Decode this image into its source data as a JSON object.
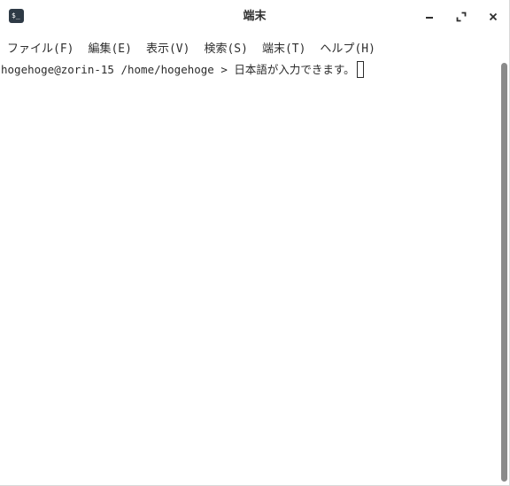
{
  "window": {
    "title": "端末",
    "app_icon_glyph": "$_"
  },
  "menubar": {
    "items": [
      {
        "label": "ファイル(F)"
      },
      {
        "label": "編集(E)"
      },
      {
        "label": "表示(V)"
      },
      {
        "label": "検索(S)"
      },
      {
        "label": "端末(T)"
      },
      {
        "label": "ヘルプ(H)"
      }
    ]
  },
  "terminal": {
    "prompt": "hogehoge@zorin-15 /home/hogehoge > ",
    "input": "日本語が入力できます。"
  },
  "icons": {
    "app": "terminal-icon",
    "minimize": "minimize-icon",
    "maximize": "maximize-icon",
    "close": "close-icon"
  },
  "colors": {
    "background": "#ffffff",
    "text": "#2b2b2b",
    "app_icon_bg": "#2e3a46",
    "scrollbar_thumb": "#8a8a8a"
  }
}
